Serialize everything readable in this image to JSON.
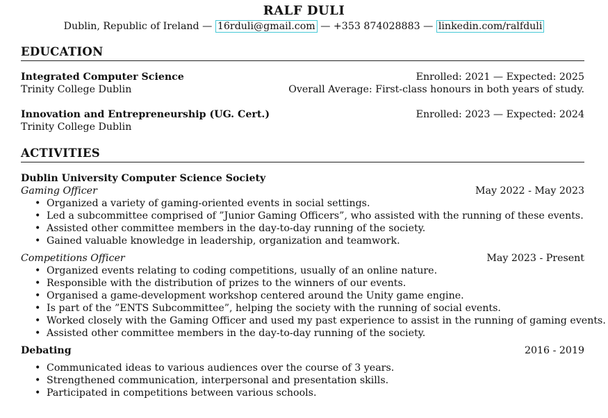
{
  "header": {
    "name": "RALF DULI",
    "location": "Dublin, Republic of Ireland",
    "sep1": " — ",
    "email": "16rduli@gmail.com",
    "sep2": " — ",
    "phone": "+353 874028883",
    "sep3": " — ",
    "linkedin": "linkedin.com/ralfduli",
    "link_box_color": "#45c8d6"
  },
  "education": {
    "title": "EDUCATION",
    "entries": [
      {
        "degree": "Integrated Computer Science",
        "dates": "Enrolled: 2021 — Expected: 2025",
        "school": "Trinity College Dublin",
        "note": "Overall Average: First-class honours in both years of study."
      },
      {
        "degree": "Innovation and Entrepreneurship (UG. Cert.)",
        "dates": "Enrolled: 2023 — Expected: 2024",
        "school": "Trinity College Dublin",
        "note": ""
      }
    ]
  },
  "activities": {
    "title": "ACTIVITIES",
    "org": "Dublin University Computer Science Society",
    "roles": [
      {
        "role": "Gaming Officer",
        "dates": "May 2022 - May 2023",
        "bullets": [
          "Organized a variety of gaming-oriented events in social settings.",
          "Led a subcommittee comprised of ”Junior Gaming Officers”, who assisted with the running of these events.",
          "Assisted other committee members in the day-to-day running of the society.",
          "Gained valuable knowledge in leadership, organization and teamwork."
        ]
      },
      {
        "role": "Competitions Officer",
        "dates": "May 2023 - Present",
        "bullets": [
          "Organized events relating to coding competitions, usually of an online nature.",
          "Responsible with the distribution of prizes to the winners of our events.",
          "Organised a game-development workshop centered around the Unity game engine.",
          "Is part of the ”ENTS Subcommittee”, helping the society with the running of social events.",
          "Worked closely with the Gaming Officer and used my past experience to assist in the running of gaming events.",
          "Assisted other committee members in the day-to-day running of the society."
        ]
      }
    ],
    "debating": {
      "title": "Debating",
      "dates": "2016 - 2019",
      "bullets": [
        "Communicated ideas to various audiences over the course of 3 years.",
        "Strengthened communication, interpersonal and presentation skills.",
        "Participated in competitions between various schools."
      ]
    }
  }
}
